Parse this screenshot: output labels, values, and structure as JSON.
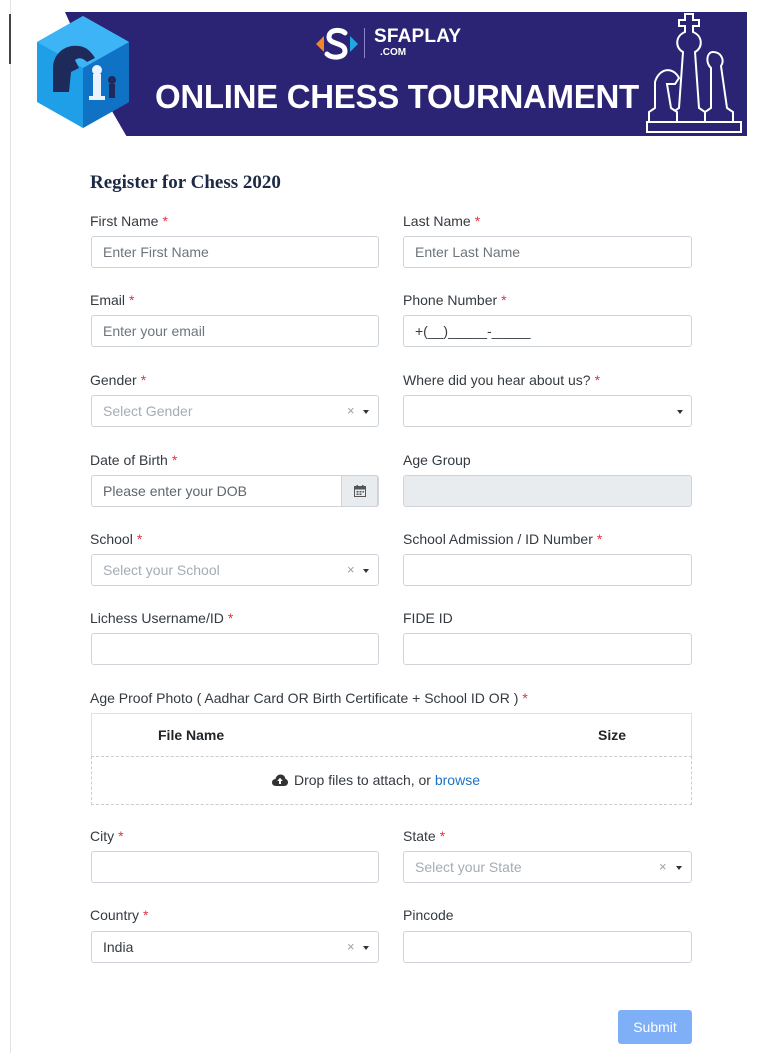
{
  "banner": {
    "brand_name": "SFAPLAY",
    "brand_sub": ".COM",
    "title": "ONLINE CHESS TOURNAMENT",
    "colors": {
      "band": "#2b2474",
      "hex": "#1e9fe8"
    }
  },
  "form": {
    "title": "Register for Chess 2020",
    "required_marker": "*",
    "first_name": {
      "label": "First Name",
      "placeholder": "Enter First Name"
    },
    "last_name": {
      "label": "Last Name",
      "placeholder": "Enter Last Name"
    },
    "email": {
      "label": "Email",
      "placeholder": "Enter your email"
    },
    "phone": {
      "label": "Phone Number",
      "placeholder": "+(__)_____-_____"
    },
    "gender": {
      "label": "Gender",
      "placeholder": "Select Gender"
    },
    "hear_about": {
      "label": "Where did you hear about us?",
      "value": ""
    },
    "dob": {
      "label": "Date of Birth",
      "placeholder": "Please enter your DOB",
      "icon": "calendar-icon"
    },
    "age_group": {
      "label": "Age Group",
      "value": ""
    },
    "school": {
      "label": "School",
      "placeholder": "Select your School"
    },
    "school_id": {
      "label": "School Admission / ID Number",
      "value": ""
    },
    "lichess": {
      "label": "Lichess Username/ID",
      "value": ""
    },
    "fide": {
      "label": "FIDE ID",
      "value": ""
    },
    "age_proof": {
      "label": "Age Proof Photo ( Aadhar Card OR Birth Certificate + School ID OR )",
      "columns": [
        "File Name",
        "Size"
      ],
      "drop_text": "Drop files to attach, or",
      "browse_text": "browse",
      "icon": "cloud-upload-icon"
    },
    "city": {
      "label": "City",
      "value": ""
    },
    "state": {
      "label": "State",
      "placeholder": "Select your State"
    },
    "country": {
      "label": "Country",
      "value": "India"
    },
    "pincode": {
      "label": "Pincode",
      "value": ""
    },
    "clear_glyph": "×",
    "submit_label": "Submit",
    "colors": {
      "required": "#dc3545",
      "submit": "#7fb0f7",
      "link": "#1a73c9"
    }
  }
}
